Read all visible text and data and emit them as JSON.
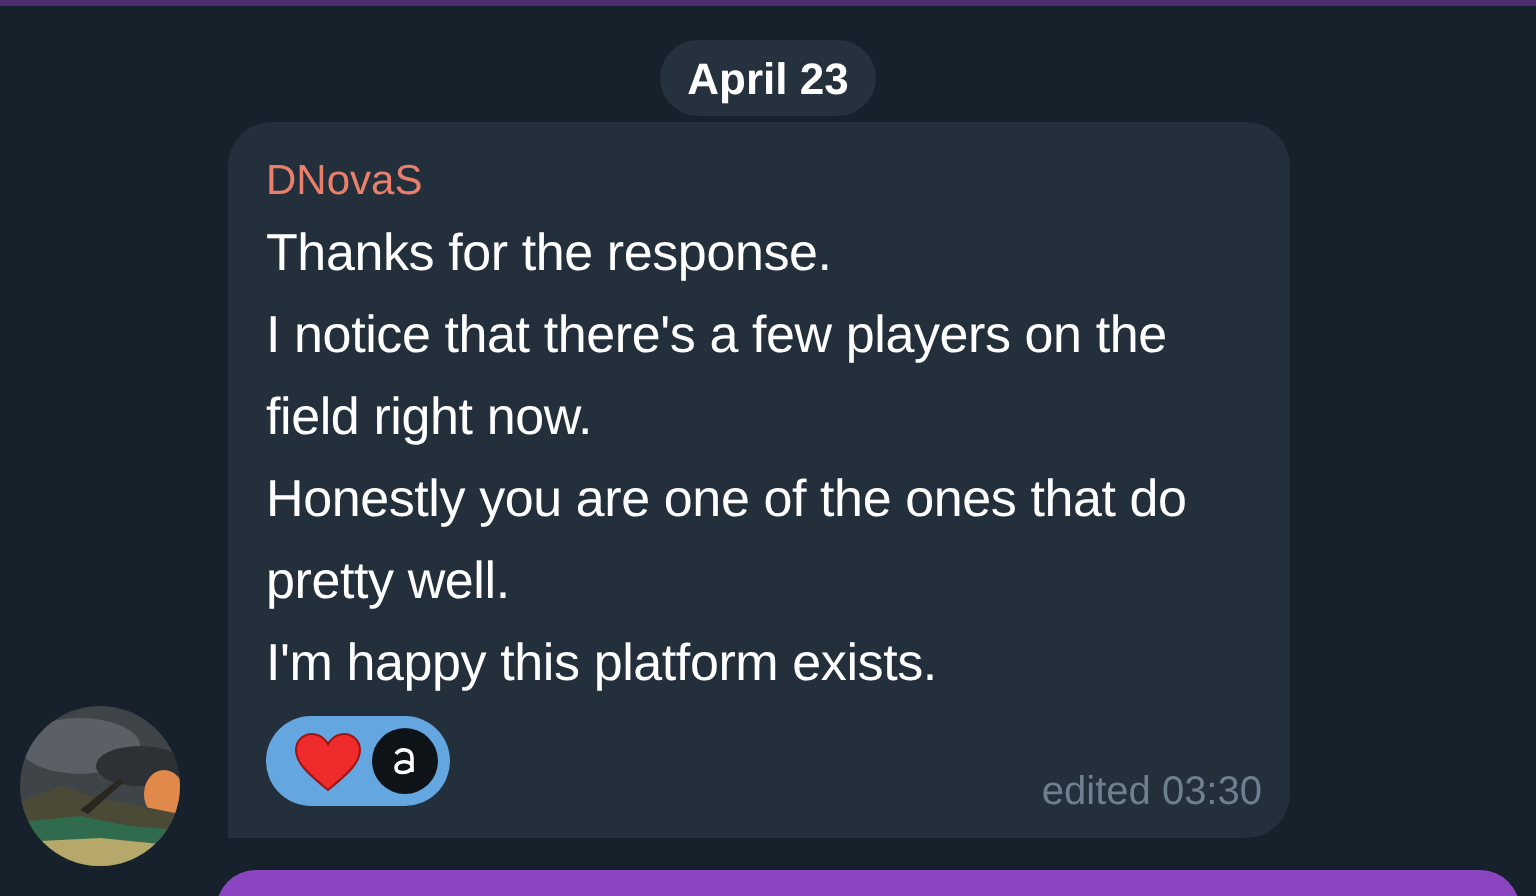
{
  "date_badge": "April 23",
  "message": {
    "sender": "DNovaS",
    "text": "Thanks for the response.\nI notice that there's a few players on the field right now.\nHonestly you are one of the ones that do pretty well.\nI'm happy this platform exists.",
    "reactions": [
      {
        "kind": "heart",
        "selected": true
      }
    ],
    "meta": "edited 03:30"
  }
}
